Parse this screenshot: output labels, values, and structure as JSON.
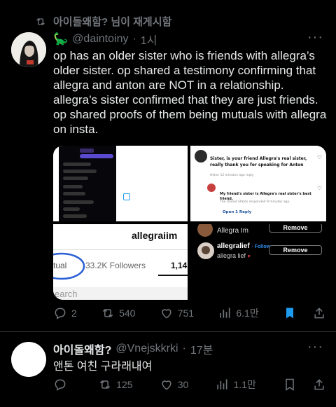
{
  "repost": {
    "label": "아이돌왜함? 님이 재게시함"
  },
  "tweet": {
    "handle": "@daintoiny",
    "time": "1시",
    "body": "op has an older sister who is friends with allegra’s older sister. op shared a testimony confirming that allegra and anton are NOT in a relationship. allegra’s sister confirmed that they are just friends. op shared proofs of them being mutuals with allegra on insta.",
    "media": {
      "comment_text": "Sister, is your friend Allegra's real sister, really thank you for speaking for Anton",
      "comment_meta": "Helen 12 minutes ago reply",
      "reply_text": "My friend's sister is Allegra's real sister's best friend.",
      "reply_meta": "The United States responded 9 minutes ago.",
      "open_reply": "Open 1 Reply",
      "profile_name": "allegraiim",
      "mutual_label": "tual",
      "followers": "33.2K Followers",
      "following_partial": "1,14",
      "search_partial": "earch",
      "user1_name": "Allegra Im",
      "user2_handle": "allegralief",
      "user2_name": "allegra lief",
      "follow_label": "· Follow",
      "remove_label": "Remove"
    },
    "actions": {
      "replies": "2",
      "reposts": "540",
      "likes": "751",
      "views": "6.1만"
    }
  },
  "reply": {
    "name": "아이돌왜함?",
    "handle": "@Vnejskkrki",
    "time": "17분",
    "body": "앤톤 여친 구라래내여",
    "actions": {
      "replies": "",
      "reposts": "125",
      "likes": "30",
      "views": "1.1만"
    }
  },
  "colors": {
    "background": "#000000",
    "text": "#e7e9ea",
    "muted": "#71767b",
    "bookmark_active": "#1d9bf0"
  },
  "icons": [
    "repost-icon",
    "dinosaur-emoji",
    "more-icon",
    "reply-icon",
    "like-icon",
    "views-icon",
    "bookmark-icon",
    "share-icon"
  ]
}
